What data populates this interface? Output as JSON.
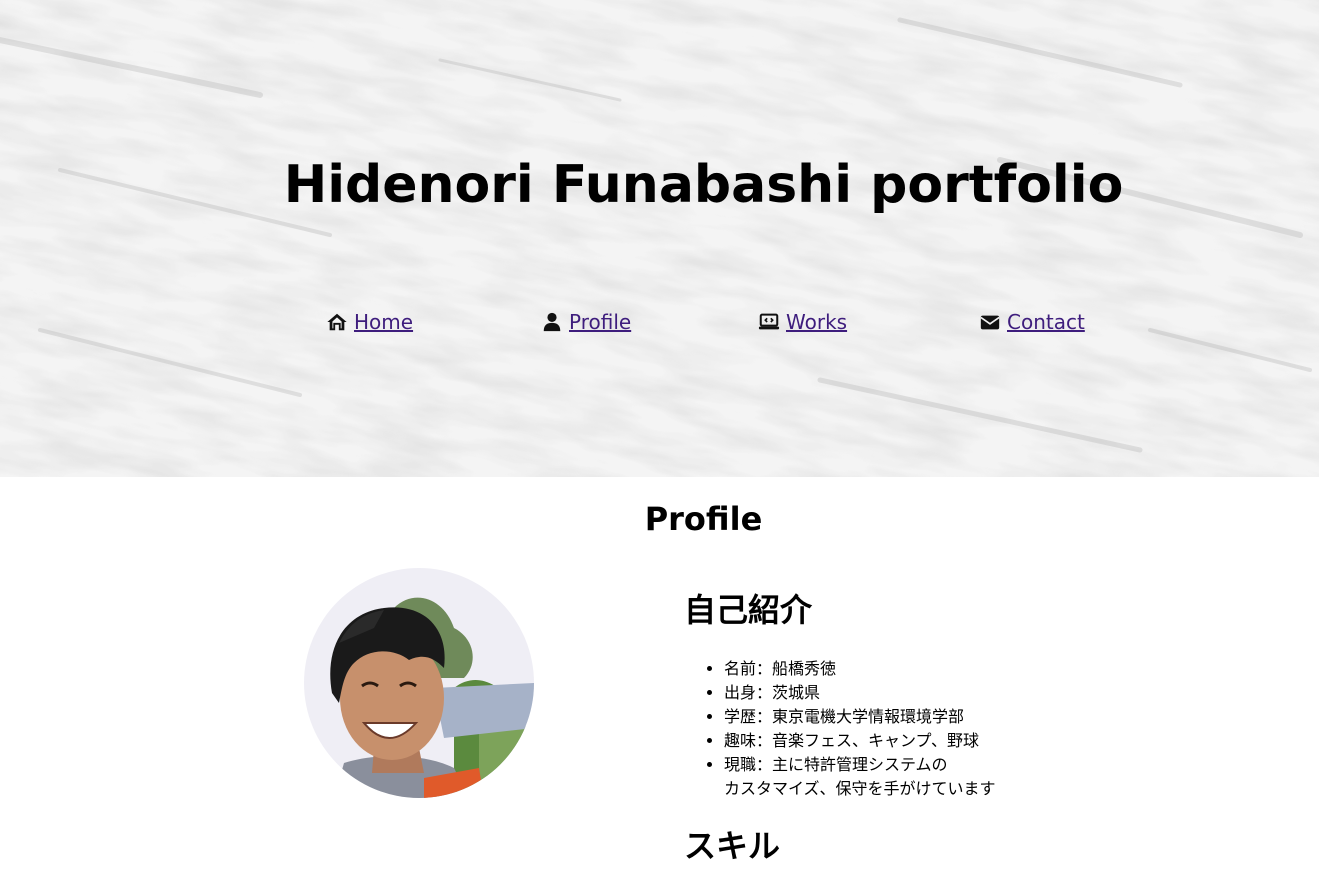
{
  "header": {
    "title": "Hidenori Funabashi portfolio"
  },
  "nav": {
    "items": [
      {
        "label": "Home",
        "icon": "home-icon"
      },
      {
        "label": "Profile",
        "icon": "user-icon"
      },
      {
        "label": "Works",
        "icon": "laptop-code-icon"
      },
      {
        "label": "Contact",
        "icon": "envelope-icon"
      }
    ],
    "link_color": "#3e1d7d"
  },
  "profile": {
    "section_title": "Profile",
    "intro_heading": "自己紹介",
    "intro_items": [
      "名前：船橋秀徳",
      "出身：茨城県",
      "学歴：東京電機大学情報環境学部",
      "趣味：音楽フェス、キャンプ、野球",
      "現職：主に特許管理システムの",
      "カスタマイズ、保守を手がけています"
    ],
    "skills_heading": "スキル"
  }
}
